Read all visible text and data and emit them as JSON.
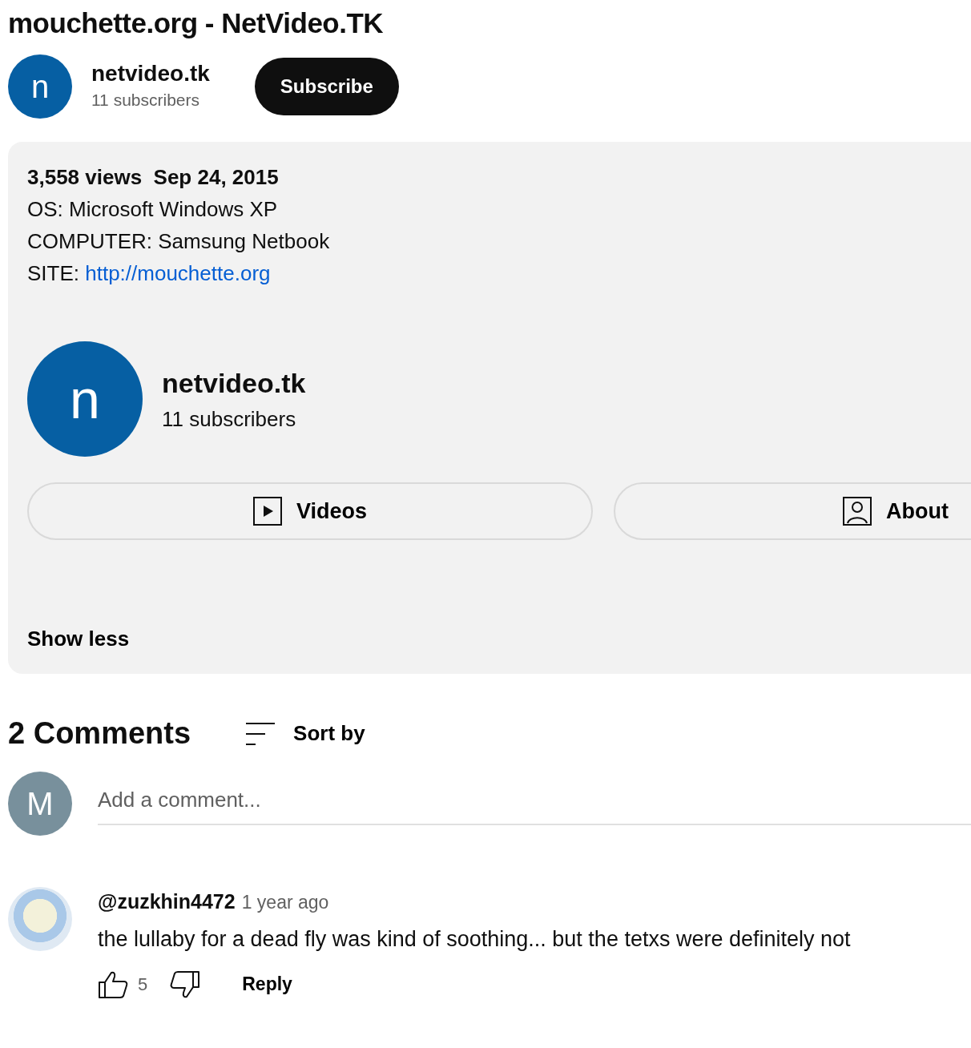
{
  "video": {
    "title": "mouchette.org - NetVideo.TK"
  },
  "channel": {
    "initial": "n",
    "name": "netvideo.tk",
    "subscribers": "11 subscribers",
    "subscribe_label": "Subscribe"
  },
  "description": {
    "views": "3,558 views",
    "date": "Sep 24, 2015",
    "lines": [
      {
        "kind": "text",
        "text": "OS: Microsoft Windows XP"
      },
      {
        "kind": "text",
        "text": "COMPUTER: Samsung Netbook"
      },
      {
        "kind": "link",
        "label": "SITE: ",
        "link": "http://mouchette.org"
      }
    ],
    "channel_card": {
      "initial": "n",
      "name": "netvideo.tk",
      "subscribers": "11 subscribers"
    },
    "buttons": [
      {
        "kind": "videos",
        "label": "Videos"
      },
      {
        "kind": "about",
        "label": "About"
      }
    ],
    "toggle": "Show less"
  },
  "comments": {
    "count": "2 Comments",
    "sort_label": "Sort by",
    "composer": {
      "initial": "M",
      "placeholder": "Add a comment..."
    },
    "items": [
      {
        "author": "@zuzkhin4472",
        "time": "1 year ago",
        "text": "the lullaby for a dead fly was kind of soothing... but the tetxs were definitely not",
        "likes": "5",
        "reply_label": "Reply"
      }
    ]
  }
}
